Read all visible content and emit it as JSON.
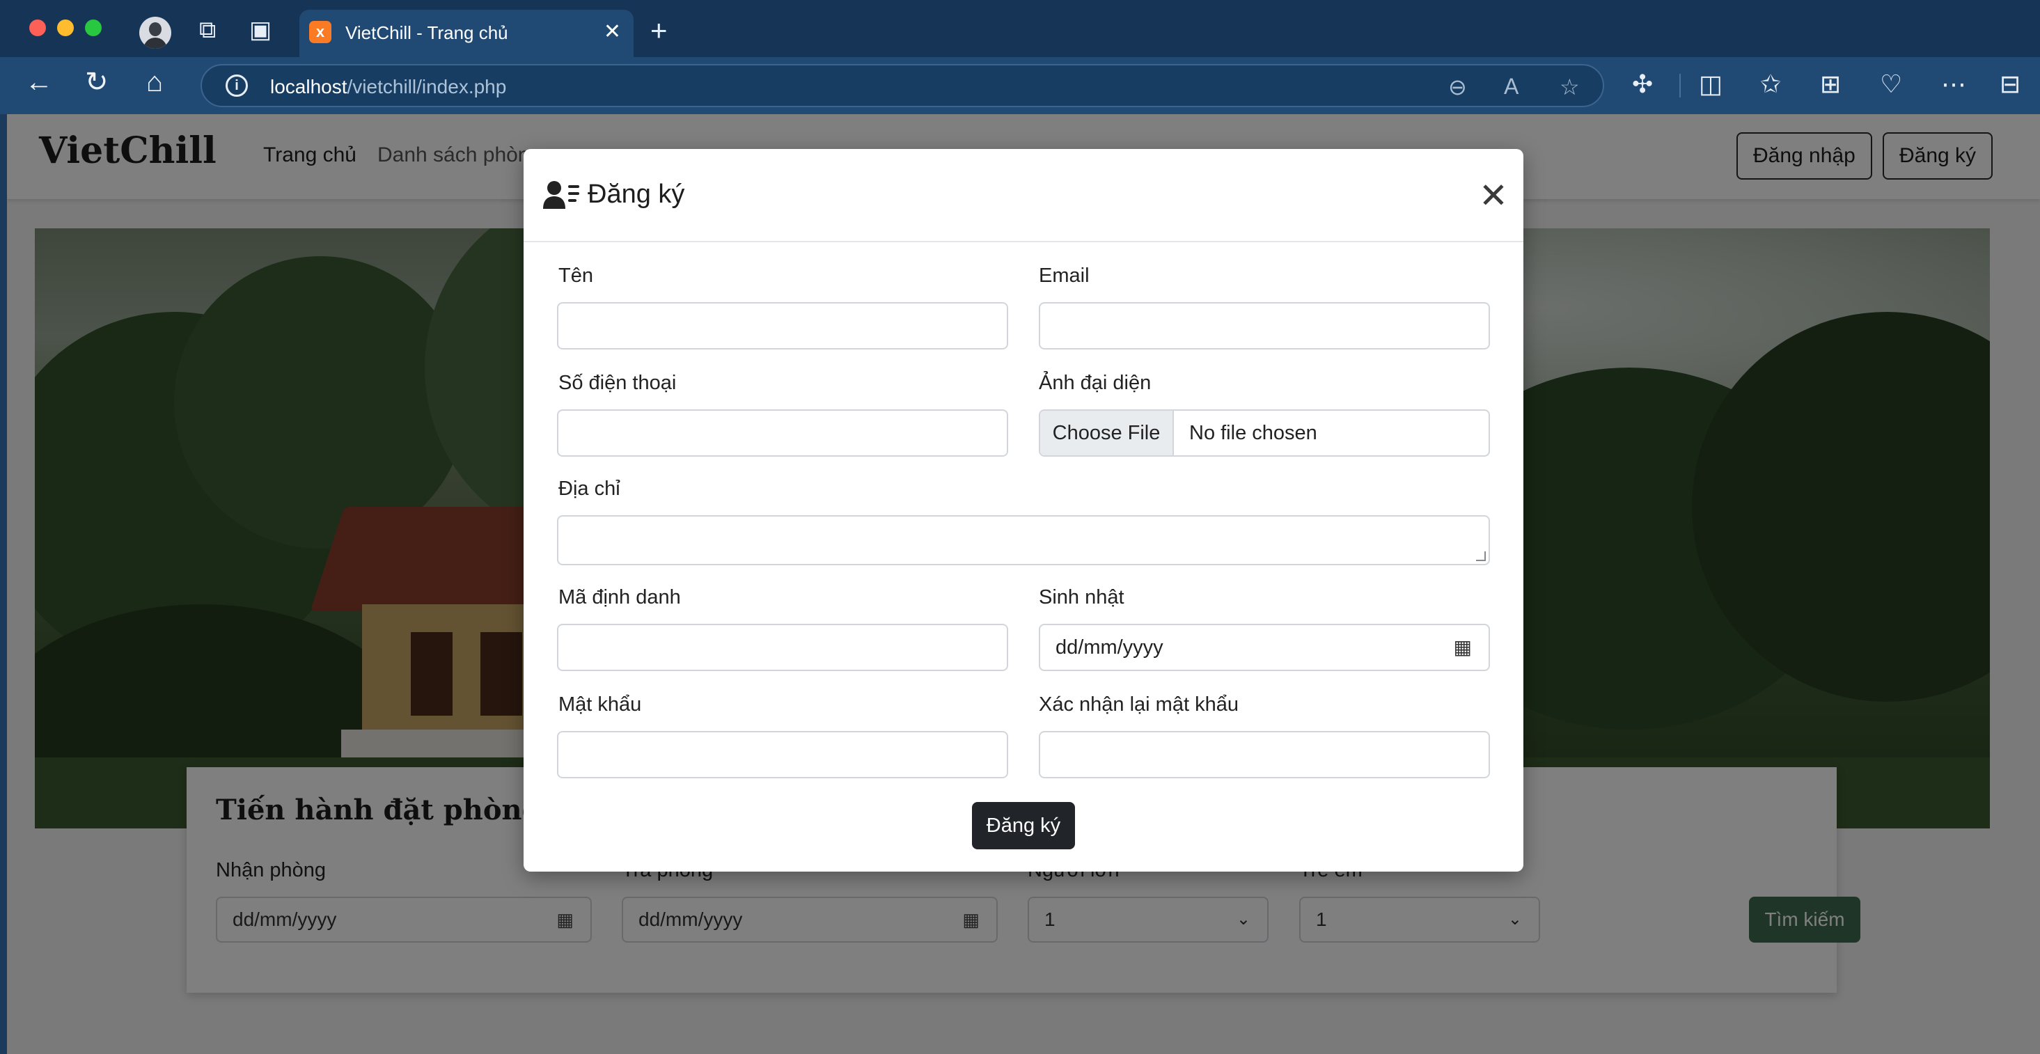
{
  "browser": {
    "tab_title": "VietChill - Trang chủ",
    "tab_favicon": "xampp-icon",
    "url_host": "localhost",
    "url_path": "/vietchill/index.php"
  },
  "site": {
    "brand": "VietChill",
    "menu": [
      {
        "label": "Trang chủ",
        "active": true
      },
      {
        "label": "Danh sách phòng",
        "active": false
      }
    ],
    "login_label": "Đăng nhập",
    "register_label": "Đăng ký"
  },
  "booking": {
    "title": "Tiến hành đặt phòng",
    "checkin_label": "Nhận phòng",
    "checkout_label": "Trả phòng",
    "adults_label": "Người lớn",
    "children_label": "Trẻ em",
    "checkin_value": "dd/mm/yyyy",
    "checkout_value": "dd/mm/yyyy",
    "adults_value": "1",
    "children_value": "1",
    "search_label": "Tìm kiếm"
  },
  "modal": {
    "title": "Đăng ký",
    "fields": {
      "name_label": "Tên",
      "email_label": "Email",
      "phone_label": "Số điện thoại",
      "avatar_label": "Ảnh đại diện",
      "file_button": "Choose File",
      "file_status": "No file chosen",
      "address_label": "Địa chỉ",
      "id_label": "Mã định danh",
      "birthday_label": "Sinh nhật",
      "birthday_placeholder": "dd/mm/yyyy",
      "password_label": "Mật khẩu",
      "confirm_label": "Xác nhận lại mật khẩu"
    },
    "submit_label": "Đăng ký"
  },
  "colors": {
    "accent_green": "#3e6b4f",
    "submit_dark": "#212529",
    "browser_chrome": "#204a74"
  }
}
